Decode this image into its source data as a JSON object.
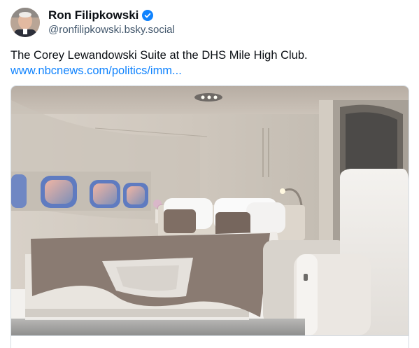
{
  "author": {
    "display_name": "Ron Filipkowski",
    "handle": "@ronfilipkowski.bsky.social",
    "verified": true,
    "avatar_icon": "avatar-photo"
  },
  "post": {
    "text": "The Corey Lewandowski Suite at the DHS Mile High Club.",
    "link_text": "www.nbcnews.com/politics/imm..."
  },
  "embed": {
    "image_subject": "aircraft-bedroom-photo"
  },
  "colors": {
    "link": "#1083fe",
    "verified_badge": "#1083fe",
    "handle": "#42576c",
    "card_border": "#d4dbe2"
  }
}
